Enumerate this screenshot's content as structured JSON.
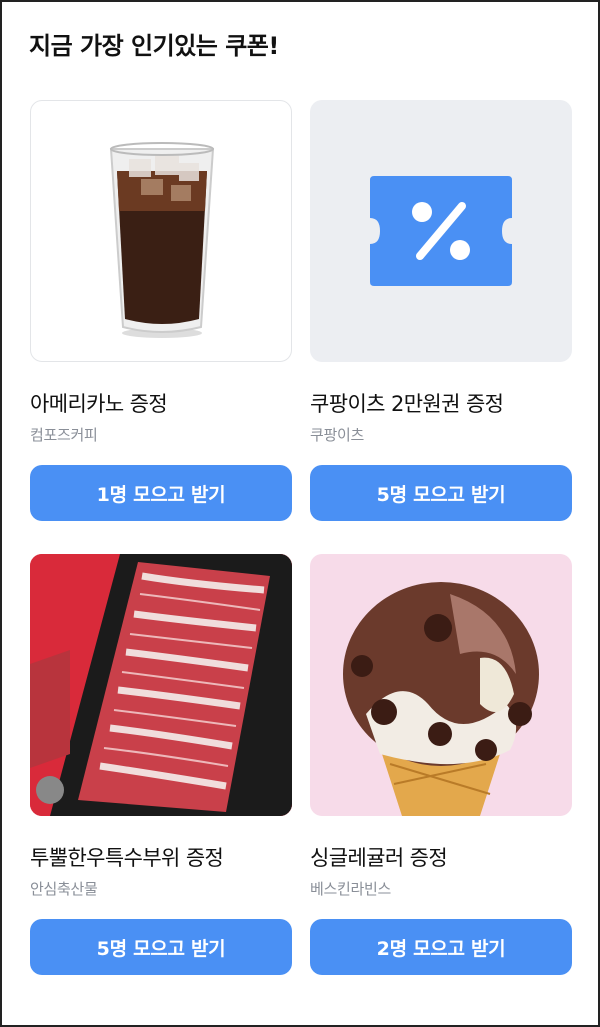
{
  "section_title": "지금 가장 인기있는 쿠폰!",
  "coupons": [
    {
      "name": "아메리카노 증정",
      "brand": "컴포즈커피",
      "button": "1명 모으고 받기",
      "image": "iced-americano-image"
    },
    {
      "name": "쿠팡이츠 2만원권 증정",
      "brand": "쿠팡이츠",
      "button": "5명 모으고 받기",
      "image": "coupon-percent-icon"
    },
    {
      "name": "투뿔한우특수부위 증정",
      "brand": "안심축산물",
      "button": "5명 모으고 받기",
      "image": "hanwoo-beef-image"
    },
    {
      "name": "싱글레귤러 증정",
      "brand": "베스킨라빈스",
      "button": "2명 모으고 받기",
      "image": "ice-cream-image"
    }
  ],
  "colors": {
    "button": "#4a90f4",
    "coupon_icon": "#4a90f4"
  }
}
